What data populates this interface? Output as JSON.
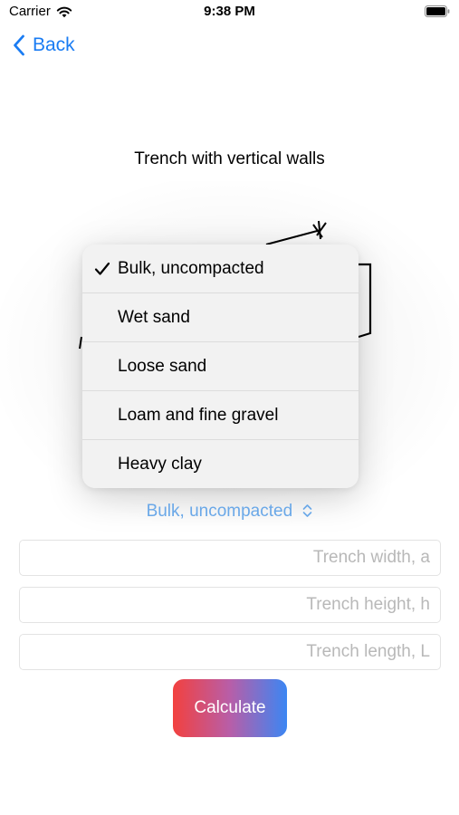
{
  "status_bar": {
    "carrier": "Carrier",
    "time": "9:38 PM",
    "wifi_icon": "wifi-icon",
    "battery_icon": "battery-icon"
  },
  "nav": {
    "back_label": "Back",
    "back_icon": "chevron-left-icon"
  },
  "title": "Trench with vertical walls",
  "soil_menu": {
    "selected": "Bulk, uncompacted",
    "items": [
      {
        "label": "Bulk, uncompacted",
        "checked": true
      },
      {
        "label": "Wet sand",
        "checked": false
      },
      {
        "label": "Loose sand",
        "checked": false
      },
      {
        "label": "Loam and fine gravel",
        "checked": false
      },
      {
        "label": "Heavy clay",
        "checked": false
      }
    ]
  },
  "inputs": {
    "width": {
      "value": "",
      "placeholder": "Trench width, a"
    },
    "height": {
      "value": "",
      "placeholder": "Trench height, h"
    },
    "length": {
      "value": "",
      "placeholder": "Trench length, L"
    }
  },
  "calculate_label": "Calculate",
  "colors": {
    "accent": "#1a7cf3",
    "picker_text": "#6aa8e8",
    "gradient_start": "#f2413f",
    "gradient_end": "#3b86f3"
  }
}
